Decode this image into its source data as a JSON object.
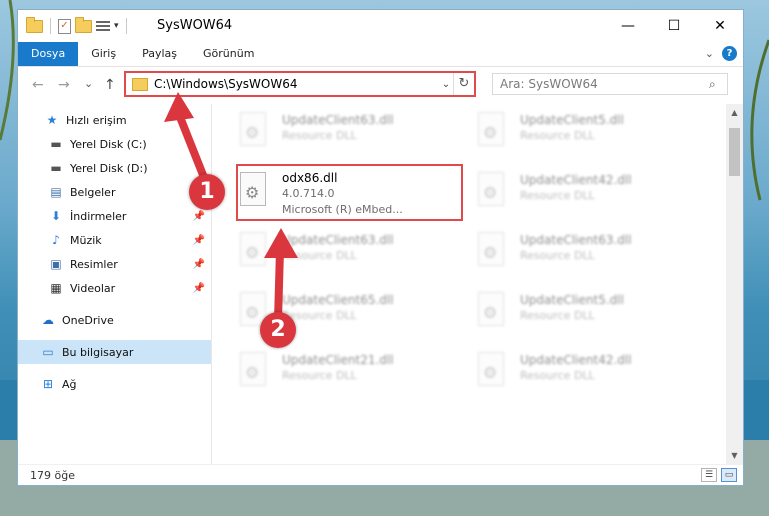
{
  "window": {
    "title": "SysWOW64",
    "controls": {
      "minimize": "—",
      "maximize": "☐",
      "close": "✕"
    }
  },
  "ribbon": {
    "tabs": [
      "Dosya",
      "Giriş",
      "Paylaş",
      "Görünüm"
    ],
    "active_tab": "Dosya",
    "help_label": "?"
  },
  "navigation": {
    "back": "←",
    "forward": "→",
    "recent": "⌄",
    "up": "↑",
    "address": "C:\\Windows\\SysWOW64",
    "refresh": "↻",
    "search_placeholder": "Ara: SysWOW64"
  },
  "sidebar": {
    "items": [
      {
        "label": "Hızlı erişim",
        "icon": "star-icon",
        "pinned": false
      },
      {
        "label": "Yerel Disk (C:)",
        "icon": "drive-icon",
        "pinned": false
      },
      {
        "label": "Yerel Disk (D:)",
        "icon": "drive-icon",
        "pinned": false
      },
      {
        "label": "Belgeler",
        "icon": "documents-icon",
        "pinned": true
      },
      {
        "label": "İndirmeler",
        "icon": "download-icon",
        "pinned": true
      },
      {
        "label": "Müzik",
        "icon": "music-icon",
        "pinned": true
      },
      {
        "label": "Resimler",
        "icon": "pictures-icon",
        "pinned": true
      },
      {
        "label": "Videolar",
        "icon": "video-icon",
        "pinned": true
      },
      {
        "label": "OneDrive",
        "icon": "cloud-icon",
        "pinned": false
      },
      {
        "label": "Bu bilgisayar",
        "icon": "computer-icon",
        "pinned": false
      },
      {
        "label": "Ağ",
        "icon": "network-icon",
        "pinned": false
      }
    ],
    "selected": "Bu bilgisayar"
  },
  "files": {
    "left_column": [
      {
        "name": "UpdateClient63.dll",
        "sub": "Resource DLL",
        "blurred": true
      },
      {
        "name": "odx86.dll",
        "line2": "4.0.714.0",
        "line3": "Microsoft (R) eMbed...",
        "blurred": false,
        "highlighted": true
      },
      {
        "name": "UpdateClient63.dll",
        "sub": "Resource DLL",
        "blurred": true
      },
      {
        "name": "UpdateClient65.dll",
        "sub": "Resource DLL",
        "blurred": true
      },
      {
        "name": "UpdateClient21.dll",
        "sub": "Resource DLL",
        "blurred": true
      }
    ],
    "right_column": [
      {
        "name": "UpdateClient5.dll",
        "sub": "Resource DLL",
        "blurred": true
      },
      {
        "name": "UpdateClient42.dll",
        "sub": "Resource DLL",
        "blurred": true
      },
      {
        "name": "UpdateClient63.dll",
        "sub": "Resource DLL",
        "blurred": true
      },
      {
        "name": "UpdateClient5.dll",
        "sub": "Resource DLL",
        "blurred": true
      },
      {
        "name": "UpdateClient42.dll",
        "sub": "Resource DLL",
        "blurred": true
      }
    ]
  },
  "status": {
    "item_count": "179 öğe"
  },
  "annotations": {
    "callouts": [
      "1",
      "2"
    ],
    "highlight_color": "#e04a4a",
    "callout_color": "#d9363e"
  }
}
